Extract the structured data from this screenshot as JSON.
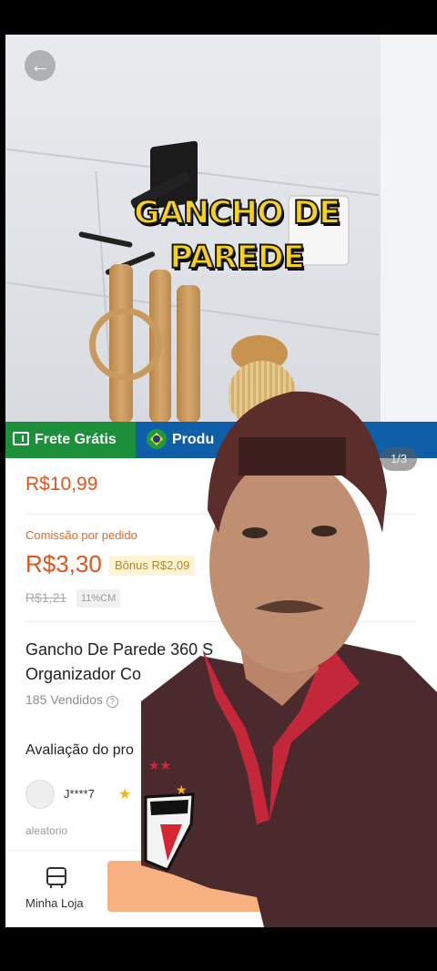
{
  "product_image": {
    "overlay_title": "GANCHO DE PAREDE",
    "counter": "1/3"
  },
  "banner": {
    "frete_label": "Frete Grátis",
    "produto_label": "Produ"
  },
  "price": "R$10,99",
  "commission": {
    "label": "Comissão por pedido",
    "value": "R$3,30",
    "bonus": "Bônus R$2,09",
    "old_value": "R$1,21",
    "percent": "11%CM"
  },
  "product": {
    "title_line1": "Gancho De Parede 360 S",
    "title_line2": "Organizador Co",
    "sold": "185 Vendidos"
  },
  "reviews": {
    "heading": "Avaliação do pro",
    "reviewer": "J****7",
    "note": "aleatorio"
  },
  "bottom": {
    "store_label": "Minha Loja"
  },
  "colors": {
    "accent": "#e0551e",
    "frete_green": "#1b8f3a",
    "produto_blue": "#0f5fa8"
  }
}
